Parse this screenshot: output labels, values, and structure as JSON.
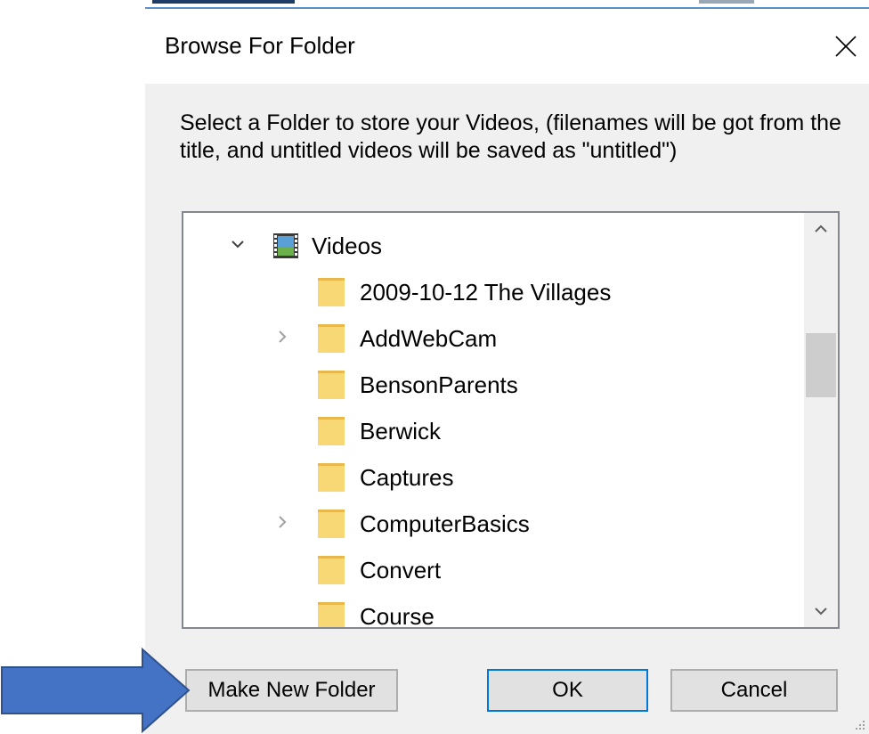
{
  "dialog": {
    "title": "Browse For Folder",
    "close_icon": "close-icon",
    "instruction": "Select a Folder to store your Videos, (filenames will be got from the title, and untitled videos will be saved as \"untitled\")"
  },
  "tree": {
    "root": {
      "label": "Videos",
      "expanded": true,
      "icon": "videos-library-icon"
    },
    "items": [
      {
        "label": "2009-10-12 The Villages",
        "has_children": false,
        "icon": "folder-icon"
      },
      {
        "label": "AddWebCam",
        "has_children": true,
        "icon": "folder-icon"
      },
      {
        "label": "BensonParents",
        "has_children": false,
        "icon": "folder-icon"
      },
      {
        "label": "Berwick",
        "has_children": false,
        "icon": "folder-icon"
      },
      {
        "label": "Captures",
        "has_children": false,
        "icon": "folder-icon"
      },
      {
        "label": "ComputerBasics",
        "has_children": true,
        "icon": "folder-icon"
      },
      {
        "label": "Convert",
        "has_children": false,
        "icon": "folder-icon"
      },
      {
        "label": "Course",
        "has_children": false,
        "icon": "folder-icon"
      }
    ]
  },
  "buttons": {
    "make_new_folder": "Make New Folder",
    "ok": "OK",
    "cancel": "Cancel"
  },
  "annotation": {
    "arrow_color": "#4472c4",
    "arrow_target": "Make New Folder"
  },
  "colors": {
    "folder": "#f8d775",
    "accent": "#0078d7"
  }
}
